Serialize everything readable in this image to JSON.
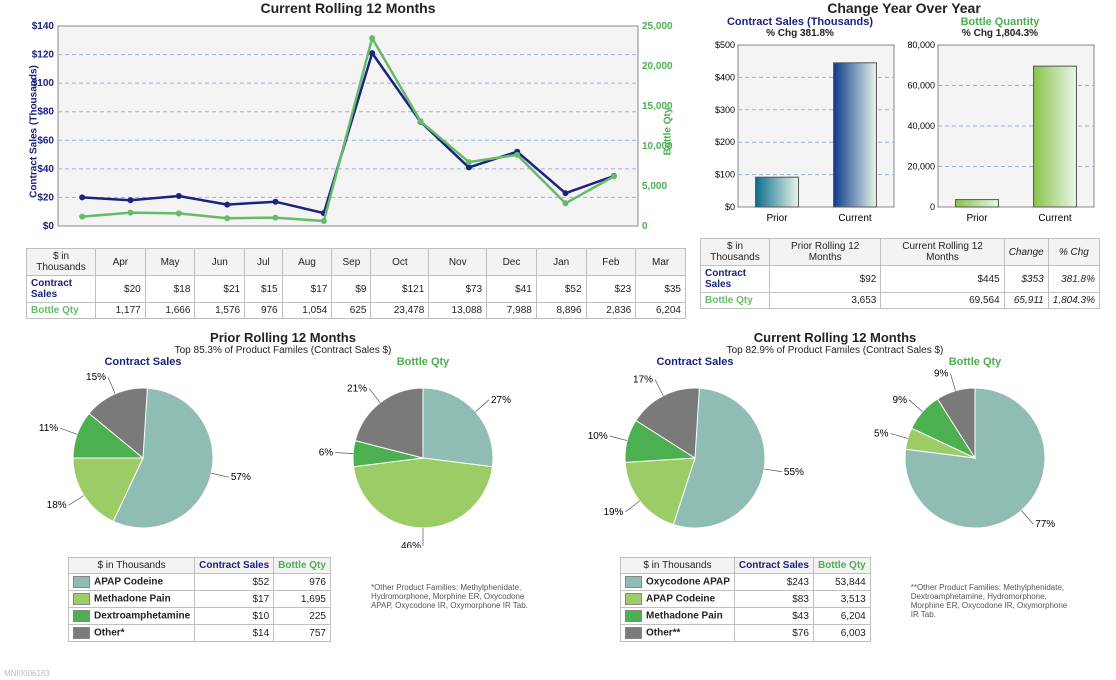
{
  "chart_data": [
    {
      "type": "line",
      "id": "rolling12_line",
      "title": "Current Rolling 12 Months",
      "xlabel": "",
      "y_left_label": "Contract Sales (Thousands)",
      "y_right_label": "Bottle Qty",
      "categories": [
        "Apr",
        "May",
        "Jun",
        "Jul",
        "Aug",
        "Sep",
        "Oct",
        "Nov",
        "Dec",
        "Jan",
        "Feb",
        "Mar"
      ],
      "y_left_lim": [
        0,
        140
      ],
      "y_right_lim": [
        0,
        25000
      ],
      "series": [
        {
          "name": "Contract Sales",
          "axis": "left",
          "values": [
            20,
            18,
            21,
            15,
            17,
            9,
            121,
            73,
            41,
            52,
            23,
            35
          ],
          "color": "#1a237e"
        },
        {
          "name": "Bottle Qty",
          "axis": "right",
          "values": [
            1177,
            1666,
            1576,
            976,
            1054,
            625,
            23478,
            13088,
            7988,
            8896,
            2836,
            6204
          ],
          "color": "#66bb6a"
        }
      ]
    },
    {
      "type": "bar",
      "id": "yoy_contract_bar",
      "title": "Contract Sales (Thousands)",
      "title_color": "#1a237e",
      "subtitle": "% Chg 381.8%",
      "categories": [
        "Prior",
        "Current"
      ],
      "values": [
        92,
        445
      ],
      "ylim": [
        0,
        500
      ],
      "ylabel": "",
      "bar_color": [
        "#0d6e8c",
        "#0d3b8c"
      ]
    },
    {
      "type": "bar",
      "id": "yoy_bottle_bar",
      "title": "Bottle Quantity",
      "title_color": "#66bb6a",
      "subtitle": "% Chg 1,804.3%",
      "categories": [
        "Prior",
        "Current"
      ],
      "values": [
        3653,
        69564
      ],
      "ylim": [
        0,
        80000
      ],
      "ylabel": "",
      "bar_color": [
        "#8bc34a",
        "#8bc34a"
      ]
    },
    {
      "type": "pie",
      "id": "prior_contract_pie",
      "title": "Contract Sales",
      "slices": [
        {
          "label": "APAP Codeine",
          "pct": 57,
          "color": "#8fbcb3"
        },
        {
          "label": "Methadone Pain",
          "pct": 18,
          "color": "#9ccc65"
        },
        {
          "label": "Dextroamphetamine",
          "pct": 11,
          "color": "#4caf50"
        },
        {
          "label": "Other*",
          "pct": 15,
          "color": "#7a7a7a"
        }
      ]
    },
    {
      "type": "pie",
      "id": "prior_bottle_pie",
      "title": "Bottle Qty",
      "slices": [
        {
          "label": "APAP Codeine",
          "pct": 27,
          "color": "#8fbcb3"
        },
        {
          "label": "Methadone Pain",
          "pct": 46,
          "color": "#9ccc65"
        },
        {
          "label": "Dextroamphetamine",
          "pct": 6,
          "color": "#4caf50"
        },
        {
          "label": "Other*",
          "pct": 21,
          "color": "#7a7a7a"
        }
      ]
    },
    {
      "type": "pie",
      "id": "current_contract_pie",
      "title": "Contract Sales",
      "slices": [
        {
          "label": "Oxycodone APAP",
          "pct": 55,
          "color": "#8fbcb3"
        },
        {
          "label": "APAP Codeine",
          "pct": 19,
          "color": "#9ccc65"
        },
        {
          "label": "Methadone Pain",
          "pct": 10,
          "color": "#4caf50"
        },
        {
          "label": "Other**",
          "pct": 17,
          "color": "#7a7a7a"
        }
      ]
    },
    {
      "type": "pie",
      "id": "current_bottle_pie",
      "title": "Bottle Qty",
      "slices": [
        {
          "label": "Oxycodone APAP",
          "pct": 77,
          "color": "#8fbcb3"
        },
        {
          "label": "APAP Codeine",
          "pct": 5,
          "color": "#9ccc65"
        },
        {
          "label": "Methadone Pain",
          "pct": 9,
          "color": "#4caf50"
        },
        {
          "label": "Other**",
          "pct": 9,
          "color": "#7a7a7a"
        }
      ]
    }
  ],
  "yoy_section_title": "Change Year Over Year",
  "rolling_table": {
    "unit_header": "$ in Thousands",
    "rows": [
      {
        "name": "Contract Sales",
        "color": "#1a237e",
        "cells": [
          "$20",
          "$18",
          "$21",
          "$15",
          "$17",
          "$9",
          "$121",
          "$73",
          "$41",
          "$52",
          "$23",
          "$35"
        ]
      },
      {
        "name": "Bottle Qty",
        "color": "#66bb6a",
        "cells": [
          "1,177",
          "1,666",
          "1,576",
          "976",
          "1,054",
          "625",
          "23,478",
          "13,088",
          "7,988",
          "8,896",
          "2,836",
          "6,204"
        ]
      }
    ]
  },
  "yoy_table": {
    "unit_header": "$ in Thousands",
    "cols": [
      "Prior Rolling 12 Months",
      "Current Rolling 12 Months",
      "Change",
      "% Chg"
    ],
    "rows": [
      {
        "name": "Contract Sales",
        "color": "#1a237e",
        "cells": [
          "$92",
          "$445",
          "$353",
          "381.8%"
        ]
      },
      {
        "name": "Bottle Qty",
        "color": "#66bb6a",
        "cells": [
          "3,653",
          "69,564",
          "65,911",
          "1,804.3%"
        ]
      }
    ]
  },
  "prior_section": {
    "title": "Prior Rolling 12 Months",
    "subtitle": "Top 85.3% of Product Familes (Contract Sales $)",
    "table": {
      "unit_header": "$ in Thousands",
      "cols": [
        "Contract Sales",
        "Bottle Qty"
      ],
      "rows": [
        {
          "name": "APAP Codeine",
          "color": "#8fbcb3",
          "cells": [
            "$52",
            "976"
          ]
        },
        {
          "name": "Methadone Pain",
          "color": "#9ccc65",
          "cells": [
            "$17",
            "1,695"
          ]
        },
        {
          "name": "Dextroamphetamine",
          "color": "#4caf50",
          "cells": [
            "$10",
            "225"
          ]
        },
        {
          "name": "Other*",
          "color": "#7a7a7a",
          "cells": [
            "$14",
            "757"
          ]
        }
      ]
    },
    "footnote": "*Other Product Families: Methylphenidate, Hydromorphone, Morphine ER, Oxycodone APAP, Oxycodone IR, Oxymorphone IR Tab."
  },
  "current_section": {
    "title": "Current Rolling 12 Months",
    "subtitle": "Top 82.9% of Product Familes (Contract Sales $)",
    "table": {
      "unit_header": "$ in Thousands",
      "cols": [
        "Contract Sales",
        "Bottle Qty"
      ],
      "rows": [
        {
          "name": "Oxycodone APAP",
          "color": "#8fbcb3",
          "cells": [
            "$243",
            "53,844"
          ]
        },
        {
          "name": "APAP Codeine",
          "color": "#9ccc65",
          "cells": [
            "$83",
            "3,513"
          ]
        },
        {
          "name": "Methadone Pain",
          "color": "#4caf50",
          "cells": [
            "$43",
            "6,204"
          ]
        },
        {
          "name": "Other**",
          "color": "#7a7a7a",
          "cells": [
            "$76",
            "6,003"
          ]
        }
      ]
    },
    "footnote": "**Other Product Families: Methylphenidate, Dextroamphetamine, Hydromorphone, Morphine ER, Oxycodone IR, Oxymorphone IR Tab."
  },
  "watermark": "MNI0006183"
}
